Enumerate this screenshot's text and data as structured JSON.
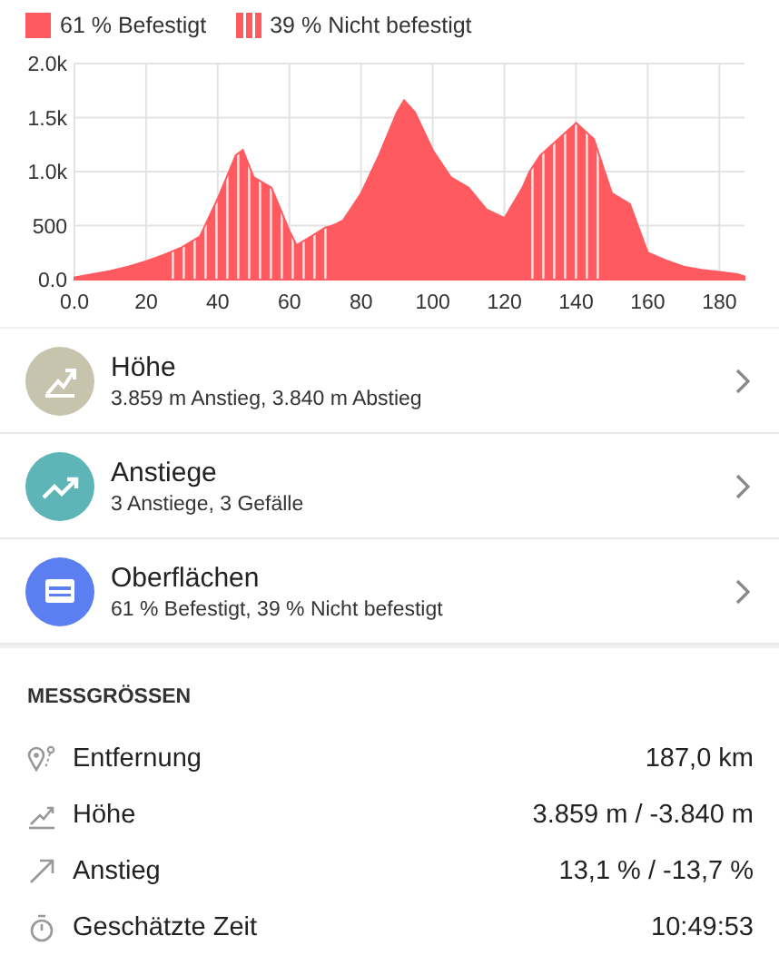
{
  "chart_data": {
    "type": "area",
    "grid": true,
    "x": [
      0,
      5,
      10,
      15,
      20,
      25,
      30,
      35,
      40,
      45,
      47,
      50,
      55,
      60,
      62,
      65,
      70,
      72,
      75,
      80,
      85,
      90,
      92,
      95,
      100,
      105,
      110,
      115,
      120,
      125,
      127,
      130,
      135,
      140,
      145,
      148,
      150,
      155,
      160,
      165,
      170,
      175,
      180,
      185,
      187
    ],
    "series": [
      {
        "name": "61 % Befestigt",
        "color": "#ff5a5f",
        "values": [
          20,
          50,
          80,
          120,
          170,
          230,
          null,
          null,
          null,
          null,
          null,
          null,
          null,
          null,
          null,
          null,
          null,
          500,
          550,
          800,
          1150,
          1550,
          1660,
          1550,
          1200,
          950,
          850,
          650,
          570,
          850,
          1000,
          null,
          null,
          null,
          null,
          1000,
          800,
          700,
          250,
          180,
          120,
          90,
          70,
          50,
          30
        ]
      },
      {
        "name": "39 % Nicht befestigt",
        "color": "#ff5a5f",
        "values": [
          null,
          null,
          null,
          null,
          null,
          230,
          300,
          400,
          750,
          1150,
          1200,
          950,
          850,
          450,
          320,
          380,
          480,
          500,
          null,
          null,
          null,
          null,
          null,
          null,
          null,
          null,
          null,
          null,
          null,
          null,
          1000,
          1150,
          1300,
          1450,
          1300,
          1000,
          null,
          null,
          null,
          null,
          null,
          null,
          null,
          null,
          null
        ]
      }
    ],
    "xlim": [
      0,
      187
    ],
    "ylim": [
      0,
      2000
    ],
    "xticks": [
      {
        "value": 0,
        "label": "0.0"
      },
      20,
      40,
      60,
      80,
      100,
      120,
      140,
      160,
      180
    ],
    "yticks": [
      {
        "value": 0,
        "label": "0.0"
      },
      500,
      {
        "value": 1000,
        "label": "1.0k"
      },
      {
        "value": 1500,
        "label": "1.5k"
      },
      {
        "value": 2000,
        "label": "2.0k"
      }
    ]
  },
  "items": [
    {
      "kind": "elevation",
      "color": "#c6c4ad",
      "title": "Höhe",
      "subtitle": "3.859 m Anstieg, 3.840 m Abstieg"
    },
    {
      "kind": "climbs",
      "color": "#5eb5b8",
      "title": "Anstiege",
      "subtitle": "3 Anstiege, 3 Gefälle"
    },
    {
      "kind": "surfaces",
      "color": "#5b7ff0",
      "title": "Oberflächen",
      "subtitle": "61 % Befestigt, 39 % Nicht befestigt"
    }
  ],
  "metrics": {
    "heading": "MESSGRÖSSEN",
    "rows": [
      {
        "kind": "distance",
        "label": "Entfernung",
        "value": "187,0 km"
      },
      {
        "kind": "elevation",
        "label": "Höhe",
        "value": "3.859 m / -3.840 m"
      },
      {
        "kind": "slope",
        "label": "Anstieg",
        "value": "13,1 % / -13,7 %"
      },
      {
        "kind": "time",
        "label": "Geschätzte Zeit",
        "value": "10:49:53"
      }
    ]
  }
}
